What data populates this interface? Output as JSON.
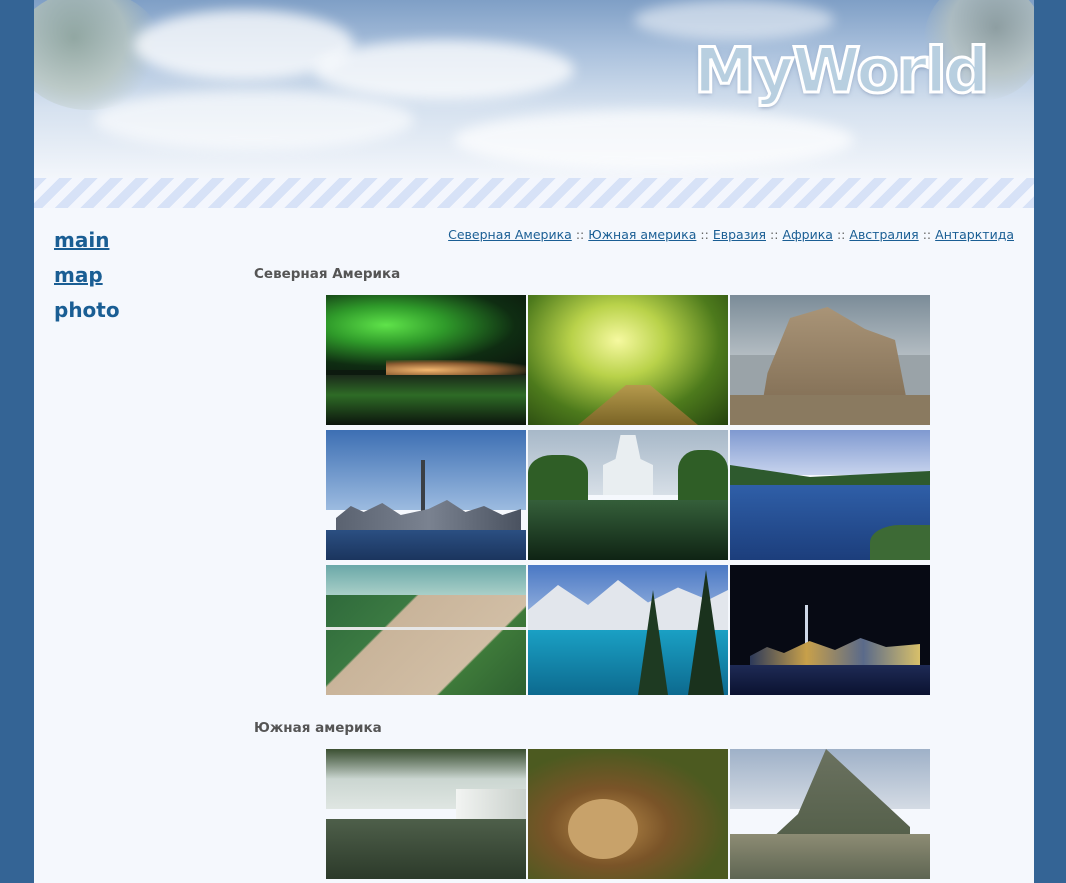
{
  "header": {
    "logo_text": "MyWorld"
  },
  "nav": {
    "items": [
      {
        "label": "main"
      },
      {
        "label": "map"
      },
      {
        "label": "photo"
      }
    ]
  },
  "regions": {
    "links": [
      "Северная Америка",
      "Южная америка",
      "Евразия",
      "Африка",
      "Австралия",
      "Антарктида"
    ],
    "separator": "::"
  },
  "sections": [
    {
      "title": "Северная Америка",
      "photos": [
        {
          "icon": "aurora-photo"
        },
        {
          "icon": "forest-path-photo"
        },
        {
          "icon": "sand-sculpture-photo"
        },
        {
          "icon": "toronto-skyline-photo"
        },
        {
          "icon": "capitol-photo"
        },
        {
          "icon": "mountain-lake-photo"
        },
        {
          "icon": "river-bridge-photo"
        },
        {
          "icon": "moraine-lake-photo"
        },
        {
          "icon": "night-city-photo"
        }
      ]
    },
    {
      "title": "Южная америка",
      "photos": [
        {
          "icon": "waterfall-photo"
        },
        {
          "icon": "sloth-photo"
        },
        {
          "icon": "machu-picchu-photo"
        }
      ]
    }
  ],
  "colors": {
    "background": "#346495",
    "page": "#f5f8fd",
    "link": "#1a5e94",
    "heading": "#555555"
  }
}
